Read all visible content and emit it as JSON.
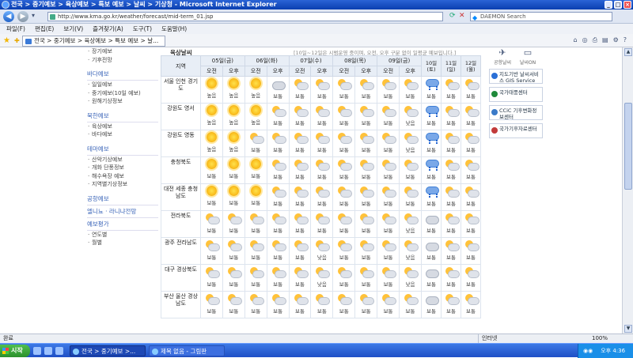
{
  "window": {
    "title": "전국 > 중기예보 > 육상예보 > 특보 예보 > 날씨 > 기상청 - Microsoft Internet Explorer"
  },
  "address": {
    "url": "http://www.kma.go.kr/weather/forecast/mid-term_01.jsp",
    "search_placeholder": "DAEMON Search"
  },
  "menu": [
    "파일(F)",
    "편집(E)",
    "보기(V)",
    "즐겨찾기(A)",
    "도구(T)",
    "도움말(H)"
  ],
  "tab": {
    "label": "전국 > 중기예보 > 육상예보 > 특보 예보 > 날..."
  },
  "sidebar": [
    {
      "type": "item",
      "label": "장기예보"
    },
    {
      "type": "item",
      "label": "기후전망"
    },
    {
      "type": "space"
    },
    {
      "type": "head",
      "label": "바다예보"
    },
    {
      "type": "item",
      "label": "일일예보"
    },
    {
      "type": "item",
      "label": "중기예보(10일 예보)"
    },
    {
      "type": "item",
      "label": "원해기상정보"
    },
    {
      "type": "space"
    },
    {
      "type": "head",
      "label": "북한예보"
    },
    {
      "type": "item",
      "label": "육상예보"
    },
    {
      "type": "item",
      "label": "바다예보"
    },
    {
      "type": "space"
    },
    {
      "type": "head",
      "label": "테마예보"
    },
    {
      "type": "item",
      "label": "산악기상예보"
    },
    {
      "type": "item",
      "label": "개화 단풍정보"
    },
    {
      "type": "item",
      "label": "해수욕장 예보"
    },
    {
      "type": "item",
      "label": "지역별기상정보"
    },
    {
      "type": "space"
    },
    {
      "type": "head",
      "label": "공항예보"
    },
    {
      "type": "head",
      "label": "엘니뇨 · 라니냐전망"
    },
    {
      "type": "head",
      "label": "예보평가"
    },
    {
      "type": "item",
      "label": "연도별"
    },
    {
      "type": "item",
      "label": "월별"
    }
  ],
  "forecast": {
    "title": "육상날씨",
    "note": "[10일~12일은 시범운영 중이며, 오전, 오후 구분 없이 일평균 예보입니다.]",
    "region_header": "지역",
    "days": [
      {
        "label": "05일(금)",
        "split": true
      },
      {
        "label": "06일(화)",
        "split": true
      },
      {
        "label": "07일(수)",
        "split": true
      },
      {
        "label": "08일(목)",
        "split": true
      },
      {
        "label": "09일(금)",
        "split": true
      },
      {
        "label": "10일 (토)",
        "split": false
      },
      {
        "label": "11일 (일)",
        "split": false
      },
      {
        "label": "12일 (월)",
        "split": false
      }
    ],
    "am": "오전",
    "pm": "오후",
    "rows": [
      {
        "region": "서울 인천 경기도",
        "cells": [
          [
            "sun",
            "높음"
          ],
          [
            "sun",
            "높음"
          ],
          [
            "sun",
            "높음"
          ],
          [
            "cl",
            "보통"
          ],
          [
            "ps",
            "보통"
          ],
          [
            "ps",
            "보통"
          ],
          [
            "ps",
            "보통"
          ],
          [
            "ps",
            "보통"
          ],
          [
            "ps",
            "보통"
          ],
          [
            "ps",
            "보통"
          ],
          [
            "rn",
            "보통"
          ],
          [
            "ps",
            "보통"
          ],
          [
            "ps",
            "보통"
          ]
        ]
      },
      {
        "region": "강원도 영서",
        "cells": [
          [
            "sun",
            "높음"
          ],
          [
            "sun",
            "높음"
          ],
          [
            "sun",
            "높음"
          ],
          [
            "ps",
            "보통"
          ],
          [
            "ps",
            "보통"
          ],
          [
            "ps",
            "보통"
          ],
          [
            "ps",
            "보통"
          ],
          [
            "ps",
            "보통"
          ],
          [
            "ps",
            "보통"
          ],
          [
            "ps",
            "낮음"
          ],
          [
            "rn",
            "보통"
          ],
          [
            "ps",
            "보통"
          ],
          [
            "ps",
            "보통"
          ]
        ]
      },
      {
        "region": "강원도 영동",
        "cells": [
          [
            "sun",
            "높음"
          ],
          [
            "sun",
            "높음"
          ],
          [
            "ps",
            "보통"
          ],
          [
            "ps",
            "보통"
          ],
          [
            "ps",
            "보통"
          ],
          [
            "ps",
            "보통"
          ],
          [
            "ps",
            "보통"
          ],
          [
            "ps",
            "보통"
          ],
          [
            "ps",
            "보통"
          ],
          [
            "ps",
            "낮음"
          ],
          [
            "rn",
            "보통"
          ],
          [
            "ps",
            "보통"
          ],
          [
            "ps",
            "보통"
          ]
        ]
      },
      {
        "region": "충청북도",
        "cells": [
          [
            "sun",
            "보통"
          ],
          [
            "sun",
            "보통"
          ],
          [
            "sun",
            "보통"
          ],
          [
            "ps",
            "보통"
          ],
          [
            "ps",
            "보통"
          ],
          [
            "ps",
            "보통"
          ],
          [
            "ps",
            "보통"
          ],
          [
            "ps",
            "보통"
          ],
          [
            "ps",
            "보통"
          ],
          [
            "ps",
            "보통"
          ],
          [
            "rn",
            "보통"
          ],
          [
            "ps",
            "보통"
          ],
          [
            "ps",
            "보통"
          ]
        ]
      },
      {
        "region": "대전 세종 충청남도",
        "cells": [
          [
            "sun",
            "보통"
          ],
          [
            "sun",
            "보통"
          ],
          [
            "sun",
            "보통"
          ],
          [
            "ps",
            "보통"
          ],
          [
            "ps",
            "보통"
          ],
          [
            "ps",
            "보통"
          ],
          [
            "ps",
            "보통"
          ],
          [
            "ps",
            "보통"
          ],
          [
            "ps",
            "보통"
          ],
          [
            "ps",
            "보통"
          ],
          [
            "rn",
            "보통"
          ],
          [
            "ps",
            "보통"
          ],
          [
            "ps",
            "보통"
          ]
        ]
      },
      {
        "region": "전라북도",
        "cells": [
          [
            "ps",
            "보통"
          ],
          [
            "ps",
            "보통"
          ],
          [
            "ps",
            "보통"
          ],
          [
            "ps",
            "보통"
          ],
          [
            "ps",
            "보통"
          ],
          [
            "ps",
            "보통"
          ],
          [
            "ps",
            "보통"
          ],
          [
            "ps",
            "보통"
          ],
          [
            "ps",
            "보통"
          ],
          [
            "ps",
            "낮음"
          ],
          [
            "cl",
            "보통"
          ],
          [
            "ps",
            "보통"
          ],
          [
            "ps",
            "보통"
          ]
        ]
      },
      {
        "region": "광주 전라남도",
        "cells": [
          [
            "ps",
            "보통"
          ],
          [
            "ps",
            "보통"
          ],
          [
            "ps",
            "보통"
          ],
          [
            "ps",
            "보통"
          ],
          [
            "ps",
            "보통"
          ],
          [
            "ps",
            "낮음"
          ],
          [
            "ps",
            "보통"
          ],
          [
            "ps",
            "보통"
          ],
          [
            "ps",
            "보통"
          ],
          [
            "ps",
            "낮음"
          ],
          [
            "cl",
            "보통"
          ],
          [
            "ps",
            "보통"
          ],
          [
            "ps",
            "보통"
          ]
        ]
      },
      {
        "region": "대구 경상북도",
        "cells": [
          [
            "ps",
            "보통"
          ],
          [
            "ps",
            "보통"
          ],
          [
            "ps",
            "보통"
          ],
          [
            "ps",
            "보통"
          ],
          [
            "ps",
            "보통"
          ],
          [
            "ps",
            "낮음"
          ],
          [
            "ps",
            "보통"
          ],
          [
            "ps",
            "보통"
          ],
          [
            "ps",
            "보통"
          ],
          [
            "ps",
            "낮음"
          ],
          [
            "cl",
            "보통"
          ],
          [
            "ps",
            "보통"
          ],
          [
            "ps",
            "보통"
          ]
        ]
      },
      {
        "region": "부산 울산 경상남도",
        "cells": [
          [
            "ps",
            "보통"
          ],
          [
            "ps",
            "보통"
          ],
          [
            "ps",
            "보통"
          ],
          [
            "ps",
            "보통"
          ],
          [
            "ps",
            "보통"
          ],
          [
            "ps",
            "보통"
          ],
          [
            "ps",
            "보통"
          ],
          [
            "ps",
            "보통"
          ],
          [
            "ps",
            "보통"
          ],
          [
            "ps",
            "보통"
          ],
          [
            "cl",
            "보통"
          ],
          [
            "ps",
            "보통"
          ],
          [
            "ps",
            "보통"
          ]
        ]
      }
    ]
  },
  "right_panel": {
    "icons": [
      {
        "icon": "airport-weather-icon",
        "label": "공항날씨"
      },
      {
        "icon": "tv-icon",
        "label": "날씨ON"
      }
    ],
    "banners": [
      {
        "text": "지도기반 날씨서비스 GIS Service",
        "color": "#2a6fd6"
      },
      {
        "text": "국가태풍센터",
        "color": "#1f8a3a"
      },
      {
        "text": "CCiC 기후변화정보센터",
        "color": "#3a7ac8"
      },
      {
        "text": "국가기후자료센터",
        "color": "#c23a3a"
      }
    ]
  },
  "status": {
    "text": "완료",
    "zone": "인터넷",
    "zoom": "100%"
  },
  "taskbar": {
    "start": "시작",
    "tasks": [
      "전국 > 중기예보 >...",
      "제목 없음 - 그림판"
    ],
    "clock": "오후 4:36"
  }
}
